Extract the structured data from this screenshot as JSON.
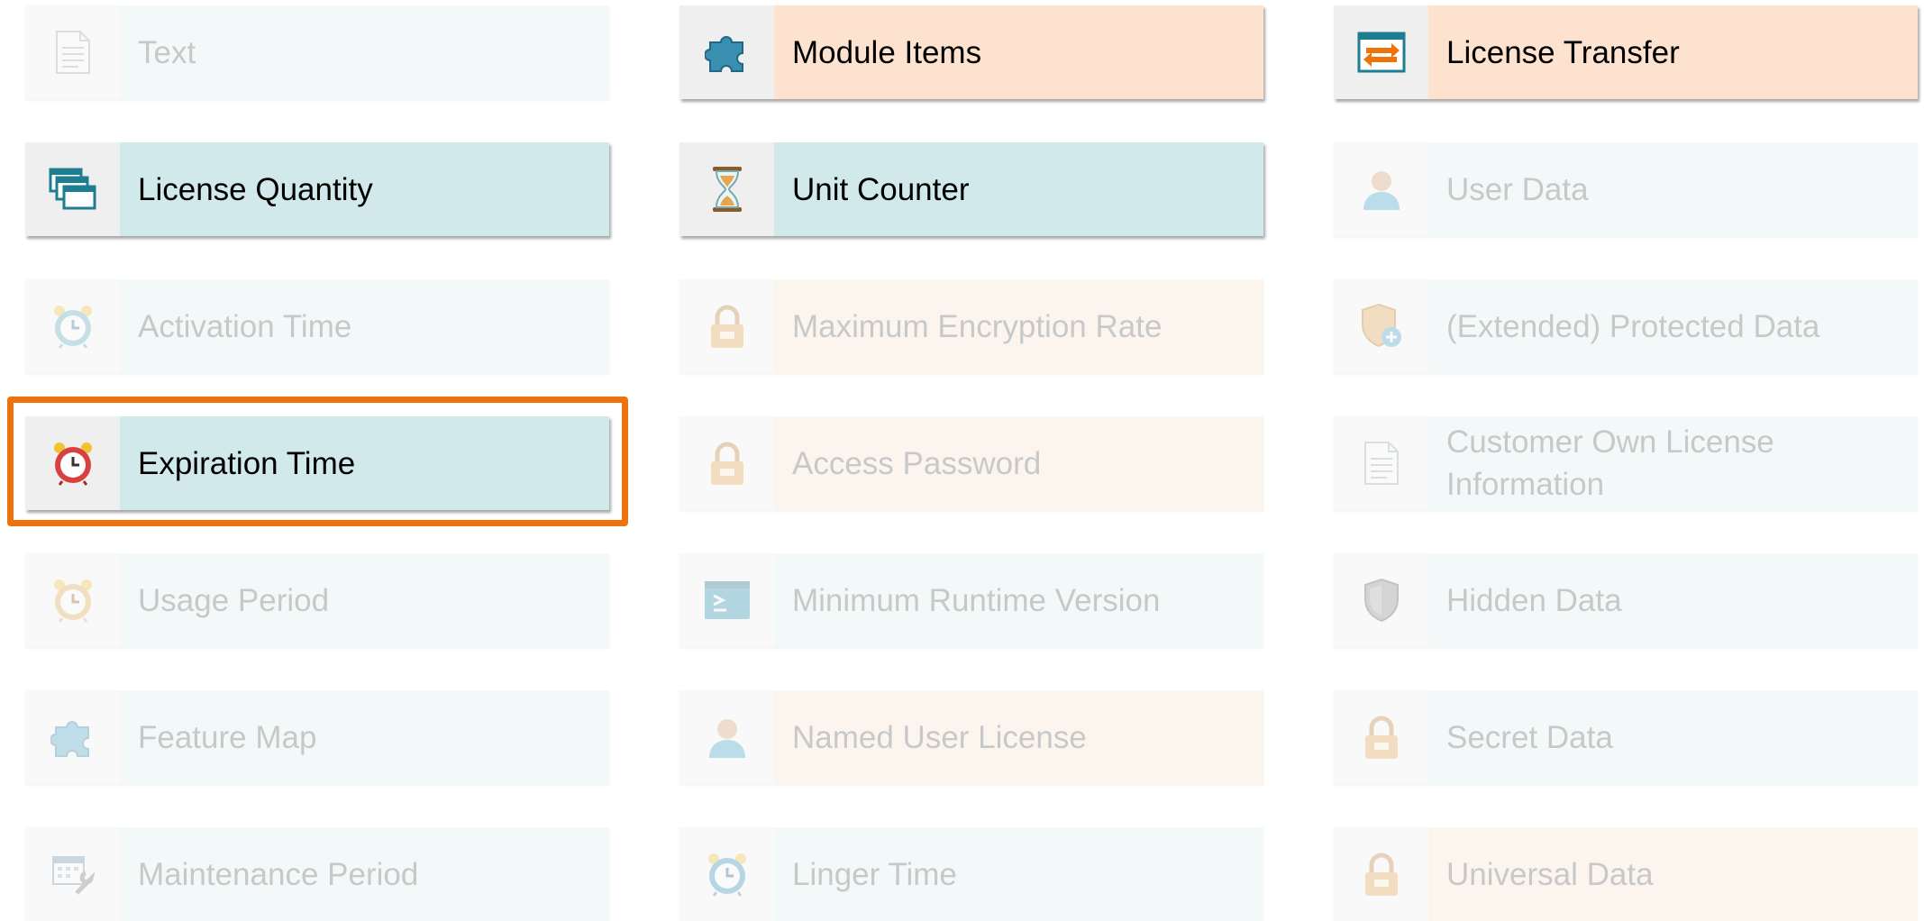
{
  "tiles": {
    "text": "Text",
    "module_items": "Module Items",
    "license_transfer": "License Transfer",
    "license_quantity": "License Quantity",
    "unit_counter": "Unit Counter",
    "user_data": "User Data",
    "activation_time": "Activation Time",
    "max_encryption_rate": "Maximum Encryption Rate",
    "extended_protected_data": "(Extended) Protected Data",
    "expiration_time": "Expiration Time",
    "access_password": "Access Password",
    "customer_own_license_info": "Customer Own License Information",
    "usage_period": "Usage Period",
    "min_runtime_version": "Minimum Runtime Version",
    "hidden_data": "Hidden Data",
    "feature_map": "Feature Map",
    "named_user_license": "Named User License",
    "secret_data": "Secret Data",
    "maintenance_period": "Maintenance Period",
    "linger_time": "Linger Time",
    "universal_data": "Universal Data"
  },
  "state": {
    "enabled": [
      "Module Items",
      "License Transfer",
      "License Quantity",
      "Unit Counter",
      "Expiration Time"
    ],
    "selected": "Expiration Time"
  },
  "colors": {
    "selection_border": "#ee730a",
    "teal_active": "#d2e9ec",
    "peach_active": "#fde3cf"
  }
}
